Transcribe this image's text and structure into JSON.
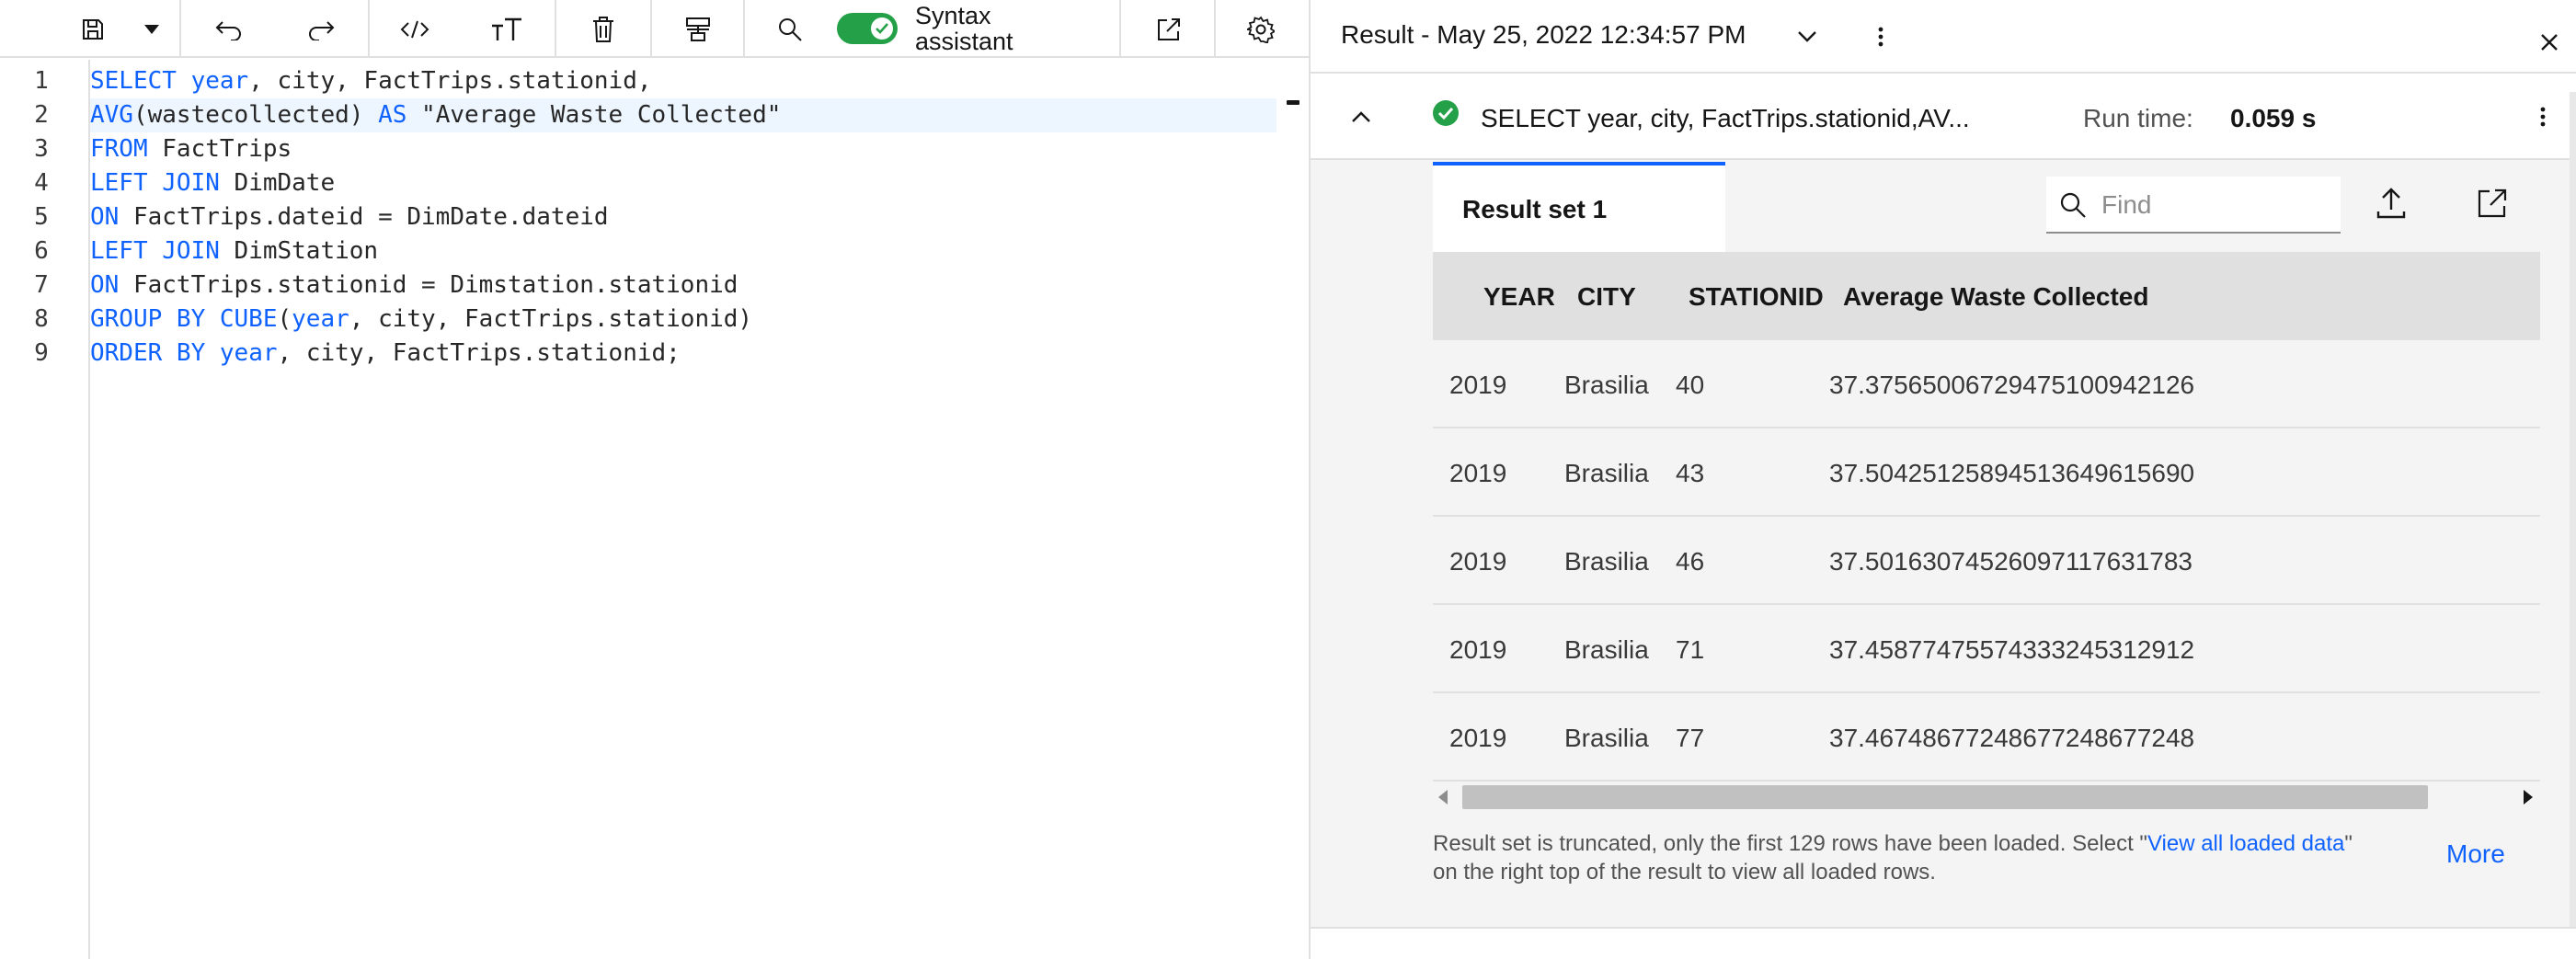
{
  "toolbar": {
    "items": [
      {
        "name": "save-icon"
      },
      {
        "name": "chevron-down-icon"
      },
      {
        "name": "undo-icon"
      },
      {
        "name": "redo-icon"
      },
      {
        "name": "code-icon"
      },
      {
        "name": "text-size-icon"
      },
      {
        "name": "delete-icon"
      },
      {
        "name": "format-icon"
      },
      {
        "name": "search-icon"
      },
      {
        "name": "launch-icon"
      },
      {
        "name": "settings-icon"
      }
    ],
    "syntax_assistant_label": "Syntax assistant",
    "syntax_assistant_on": true
  },
  "editor": {
    "line_numbers": [
      "1",
      "2",
      "3",
      "4",
      "5",
      "6",
      "7",
      "8",
      "9"
    ],
    "active_line": 2,
    "lines": [
      [
        {
          "t": "SELECT",
          "k": "kw"
        },
        {
          "t": " year",
          "k": "kw"
        },
        {
          "t": ", city, FactTrips.stationid,",
          "k": "tx"
        }
      ],
      [
        {
          "t": "AVG",
          "k": "kw"
        },
        {
          "t": "(wastecollected) ",
          "k": "tx"
        },
        {
          "t": "AS",
          "k": "kw"
        },
        {
          "t": " \"Average Waste Collected\"",
          "k": "st"
        }
      ],
      [
        {
          "t": "FROM",
          "k": "kw"
        },
        {
          "t": " FactTrips",
          "k": "tx"
        }
      ],
      [
        {
          "t": "LEFT JOIN",
          "k": "kw"
        },
        {
          "t": " DimDate",
          "k": "tx"
        }
      ],
      [
        {
          "t": "ON",
          "k": "kw"
        },
        {
          "t": " FactTrips.dateid = DimDate.dateid",
          "k": "tx"
        }
      ],
      [
        {
          "t": "LEFT JOIN",
          "k": "kw"
        },
        {
          "t": " DimStation",
          "k": "tx"
        }
      ],
      [
        {
          "t": "ON",
          "k": "kw"
        },
        {
          "t": " FactTrips.stationid = Dimstation.stationid",
          "k": "tx"
        }
      ],
      [
        {
          "t": "GROUP BY CUBE",
          "k": "kw"
        },
        {
          "t": "(",
          "k": "tx"
        },
        {
          "t": "year",
          "k": "kw"
        },
        {
          "t": ", city, FactTrips.stationid)",
          "k": "tx"
        }
      ],
      [
        {
          "t": "ORDER BY",
          "k": "kw"
        },
        {
          "t": " year",
          "k": "kw"
        },
        {
          "t": ", city, FactTrips.stationid;",
          "k": "tx"
        }
      ]
    ]
  },
  "result": {
    "title": "Result - May 25, 2022 12:34:57 PM",
    "query_summary": "SELECT year, city, FactTrips.stationid,AV...",
    "runtime_label": "Run time:",
    "runtime_value": "0.059 s",
    "tab_label": "Result set 1",
    "find_placeholder": "Find",
    "columns": [
      "YEAR",
      "CITY",
      "STATIONID",
      "Average Waste Collected"
    ],
    "rows": [
      [
        "2019",
        "Brasilia",
        "40",
        "37.37565006729475100942126"
      ],
      [
        "2019",
        "Brasilia",
        "43",
        "37.50425125894513649615690"
      ],
      [
        "2019",
        "Brasilia",
        "46",
        "37.50163074526097117631783"
      ],
      [
        "2019",
        "Brasilia",
        "71",
        "37.45877475574333245312912"
      ],
      [
        "2019",
        "Brasilia",
        "77",
        "37.46748677248677248677248"
      ]
    ],
    "notice_before": "Result set is truncated, only the first 129 rows have been loaded. Select \"",
    "notice_link": "View all loaded data",
    "notice_after": "\" on the right top of the result to view all loaded rows.",
    "more_label": "More"
  },
  "colors": {
    "accent": "#0f62fe",
    "success": "#24a148",
    "toggle_on": "#24a148"
  }
}
